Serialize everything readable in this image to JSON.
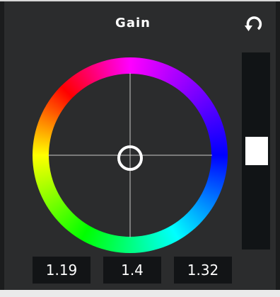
{
  "title": "Gain",
  "icons": {
    "reset": "reset-rotate-icon"
  },
  "colors": {
    "background": "#2b2c2d",
    "field": "#121416",
    "text": "#ffffff",
    "crosshair": "#c8c8c8"
  },
  "values": {
    "r": "1.19",
    "g": "1.4",
    "b": "1.32"
  },
  "slider": {
    "level_fraction": 0.5
  }
}
